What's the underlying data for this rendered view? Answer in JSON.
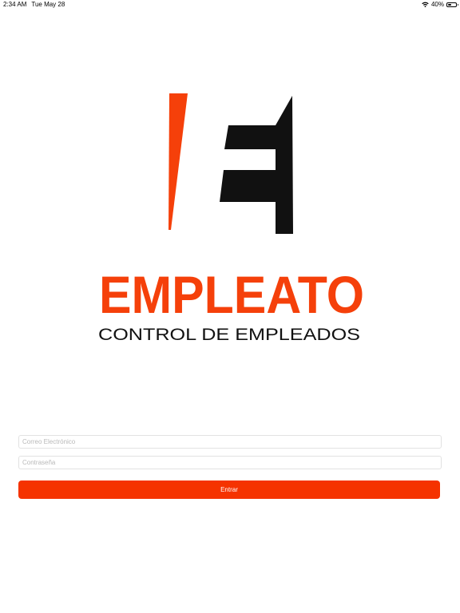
{
  "status_bar": {
    "time": "2:34 AM",
    "date": "Tue May 28",
    "battery_percent": "40%",
    "battery_level": 0.4
  },
  "brand": {
    "name": "EMPLEATO",
    "tagline": "CONTROL DE EMPLEADOS",
    "accent_color": "#f5400a",
    "dark_color": "#111111"
  },
  "form": {
    "email_placeholder": "Correo Electrónico",
    "email_value": "",
    "password_placeholder": "Contraseña",
    "password_value": "",
    "submit_label": "Entrar",
    "submit_color": "#f53300"
  },
  "icons": {
    "wifi": "wifi-icon",
    "battery": "battery-icon"
  }
}
